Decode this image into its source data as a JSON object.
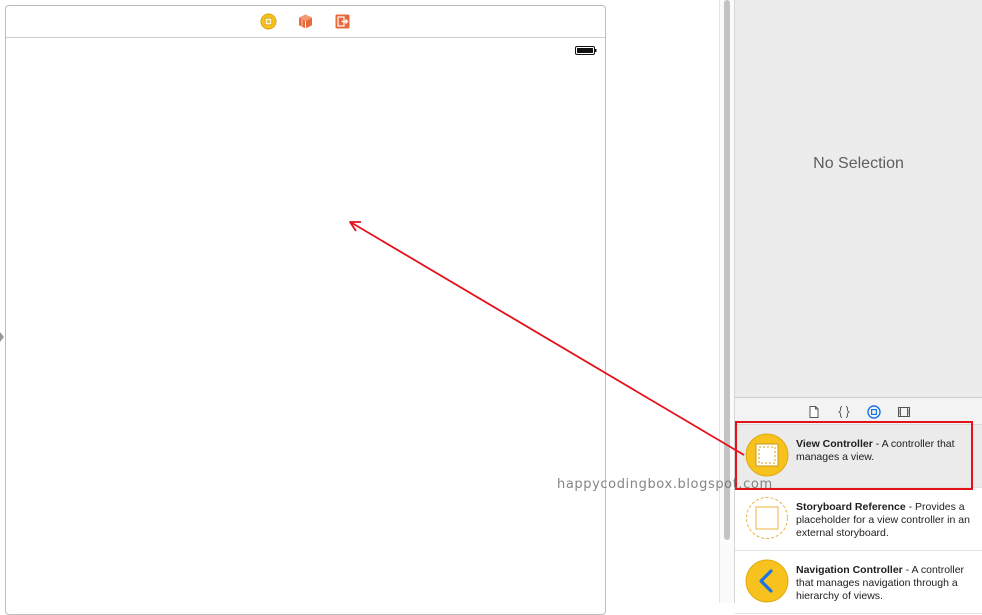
{
  "inspector": {
    "empty_label": "No Selection"
  },
  "library": {
    "tabs": [
      "file-template-library",
      "code-snippet-library",
      "object-library",
      "media-library"
    ],
    "selected_tab": "object-library",
    "items": [
      {
        "title": "View Controller",
        "description": " - A controller that manages a view.",
        "icon": "view-controller-icon"
      },
      {
        "title": "Storyboard Reference",
        "description": " - Provides a placeholder for a view controller in an external storyboard.",
        "icon": "storyboard-reference-icon"
      },
      {
        "title": "Navigation Controller",
        "description": " - A controller that manages navigation through a hierarchy of views.",
        "icon": "navigation-controller-icon"
      }
    ]
  },
  "scene_dock": {
    "icons": [
      "view-controller-icon",
      "first-responder-icon",
      "exit-icon"
    ]
  },
  "watermark": "happycodingbox.blogspot.com",
  "colors": {
    "accent_yellow": "#f7c21e",
    "annotation_red": "#e3121b",
    "dock_orange": "#e8693a",
    "selected_tab_blue": "#1a73e8"
  }
}
